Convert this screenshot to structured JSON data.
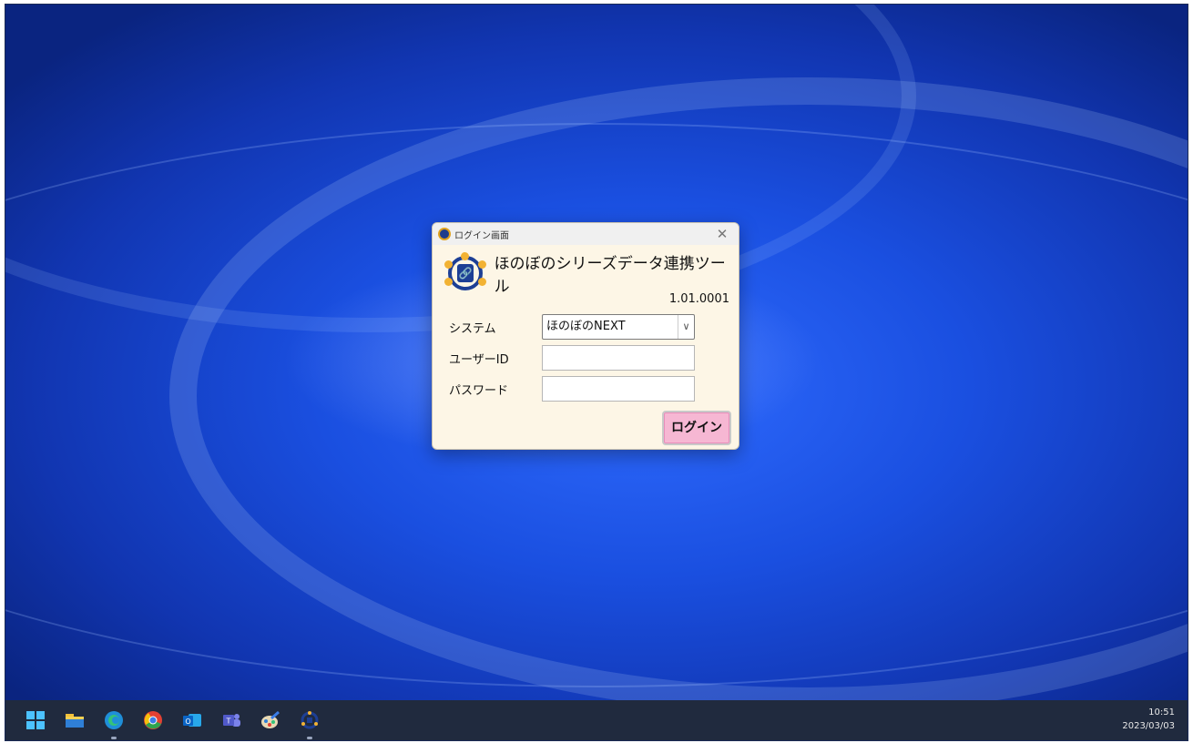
{
  "dialog": {
    "window_title": "ログイン画面",
    "close_glyph": "✕",
    "app_title": "ほのぼのシリーズデータ連携ツール",
    "version": "1.01.0001",
    "system_label": "システム",
    "system_value": "ほのぼのNEXT",
    "userid_label": "ユーザーID",
    "userid_value": "",
    "password_label": "パスワード",
    "password_value": "",
    "login_label": "ログイン"
  },
  "taskbar": {
    "icons": [
      "start-icon",
      "file-explorer-icon",
      "edge-icon",
      "chrome-icon",
      "outlook-icon",
      "teams-icon",
      "paint-icon",
      "honobono-tool-icon"
    ],
    "time": "10:51",
    "date": "2023/03/03"
  },
  "colors": {
    "dialog_bg": "#fdf6e6",
    "login_button": "#f6b7d3",
    "logo_blue": "#1d3f95",
    "logo_accent": "#f2b233"
  }
}
